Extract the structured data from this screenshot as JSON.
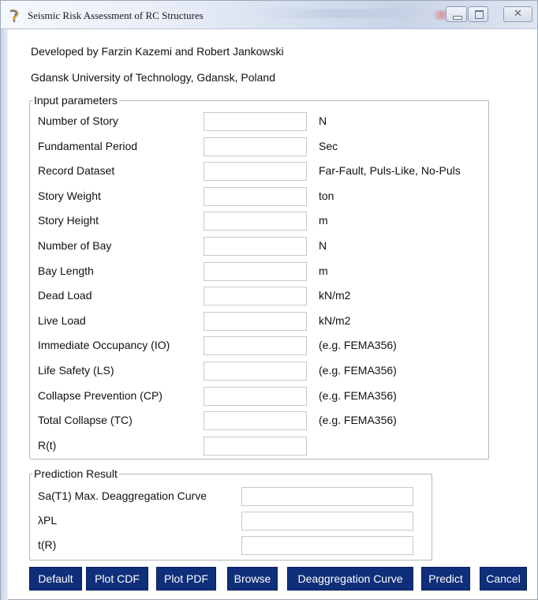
{
  "window": {
    "title": "Seismic Risk Assessment of RC Structures"
  },
  "header": {
    "developers": "Developed by Farzin Kazemi and Robert Jankowski",
    "affiliation": "Gdansk University of Technology, Gdansk, Poland"
  },
  "input_parameters": {
    "legend": "Input parameters",
    "rows": [
      {
        "label": "Number of Story",
        "value": "",
        "unit": "N"
      },
      {
        "label": "Fundamental Period",
        "value": "",
        "unit": "Sec"
      },
      {
        "label": "Record Dataset",
        "value": "",
        "unit": "Far-Fault, Puls-Like, No-Puls"
      },
      {
        "label": "Story Weight",
        "value": "",
        "unit": "ton"
      },
      {
        "label": "Story Height",
        "value": "",
        "unit": "m"
      },
      {
        "label": "Number of Bay",
        "value": "",
        "unit": "N"
      },
      {
        "label": "Bay Length",
        "value": "",
        "unit": "m"
      },
      {
        "label": "Dead Load",
        "value": "",
        "unit": "kN/m2"
      },
      {
        "label": "Live Load",
        "value": "",
        "unit": "kN/m2"
      },
      {
        "label": "Immediate Occupancy (IO)",
        "value": "",
        "unit": "(e.g. FEMA356)"
      },
      {
        "label": "Life Safety (LS)",
        "value": "",
        "unit": "(e.g. FEMA356)"
      },
      {
        "label": "Collapse Prevention (CP)",
        "value": "",
        "unit": "(e.g. FEMA356)"
      },
      {
        "label": "Total Collapse (TC)",
        "value": "",
        "unit": "(e.g. FEMA356)"
      },
      {
        "label": "R(t)",
        "value": "",
        "unit": ""
      }
    ]
  },
  "prediction_result": {
    "legend": "Prediction Result",
    "rows": [
      {
        "label": "Sa(T1) Max. Deaggregation Curve",
        "value": ""
      },
      {
        "label": "λPL",
        "value": ""
      },
      {
        "label": "t(R)",
        "value": ""
      }
    ]
  },
  "buttons": {
    "default": "Default",
    "plot_cdf": "Plot CDF",
    "plot_pdf": "Plot PDF",
    "browse": "Browse",
    "deaggregation_curve": "Deaggregation Curve",
    "predict": "Predict",
    "cancel": "Cancel"
  },
  "colors": {
    "button_bg": "#0f2f7a",
    "button_text": "#ffffff"
  }
}
